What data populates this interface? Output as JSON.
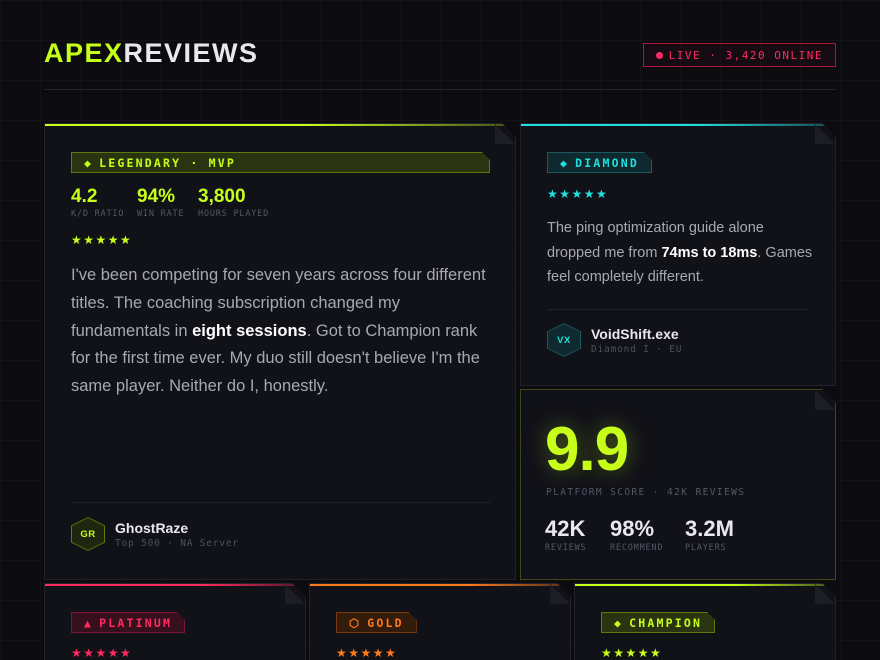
{
  "header": {
    "logo_part1": "APEX",
    "logo_part2": "REVIEWS",
    "live_label": "LIVE · 3,420 ONLINE"
  },
  "main_review": {
    "badge": "LEGENDARY · MVP",
    "badge_icon": "diamond-icon",
    "stats": [
      {
        "value": "4.2",
        "label": "K/D RATIO"
      },
      {
        "value": "94%",
        "label": "WIN RATE"
      },
      {
        "value": "3,800",
        "label": "HOURS PLAYED"
      }
    ],
    "stars": "★★★★★",
    "rating": 5,
    "quote_before": "I've been competing for seven years across four different titles. The coaching subscription changed my fundamentals in ",
    "quote_bold": "eight sessions",
    "quote_after": ". Got to Champion rank for the first time ever. My duo still doesn't believe I'm the same player. Neither do I, honestly.",
    "author": {
      "initials": "GR",
      "name": "GhostRaze",
      "meta": "Top 500 · NA Server"
    }
  },
  "side_review": {
    "badge": "DIAMOND",
    "badge_icon": "diamond-icon",
    "stars": "★★★★★",
    "rating": 5,
    "quote_before": "The ping optimization guide alone dropped me from ",
    "quote_bold": "74ms to 18ms",
    "quote_after": ". Games feel completely different.",
    "author": {
      "initials": "VX",
      "name": "VoidShift.exe",
      "meta": "Diamond I · EU"
    }
  },
  "score": {
    "value": "9.9",
    "label": "PLATFORM SCORE · 42K REVIEWS",
    "stats": [
      {
        "value": "42K",
        "label": "REVIEWS"
      },
      {
        "value": "98%",
        "label": "RECOMMEND"
      },
      {
        "value": "3.2M",
        "label": "PLAYERS"
      }
    ]
  },
  "bottom_reviews": [
    {
      "badge": "PLATINUM",
      "icon": "triangle-icon",
      "icon_glyph": "▲",
      "stars": "★★★★★",
      "accent": "#ff2a5f"
    },
    {
      "badge": "GOLD",
      "icon": "hexagon-icon",
      "icon_glyph": "⬡",
      "stars": "★★★★★",
      "accent": "#ff7a1a"
    },
    {
      "badge": "CHAMPION",
      "icon": "diamond-icon",
      "icon_glyph": "◆",
      "stars": "★★★★★",
      "accent": "#c6ff1a"
    }
  ],
  "colors": {
    "lime": "#c6ff1a",
    "cyan": "#1ee0e0",
    "red": "#ff2a5f",
    "orange": "#ff7a1a",
    "background": "#0c0c10",
    "card": "#111118"
  }
}
